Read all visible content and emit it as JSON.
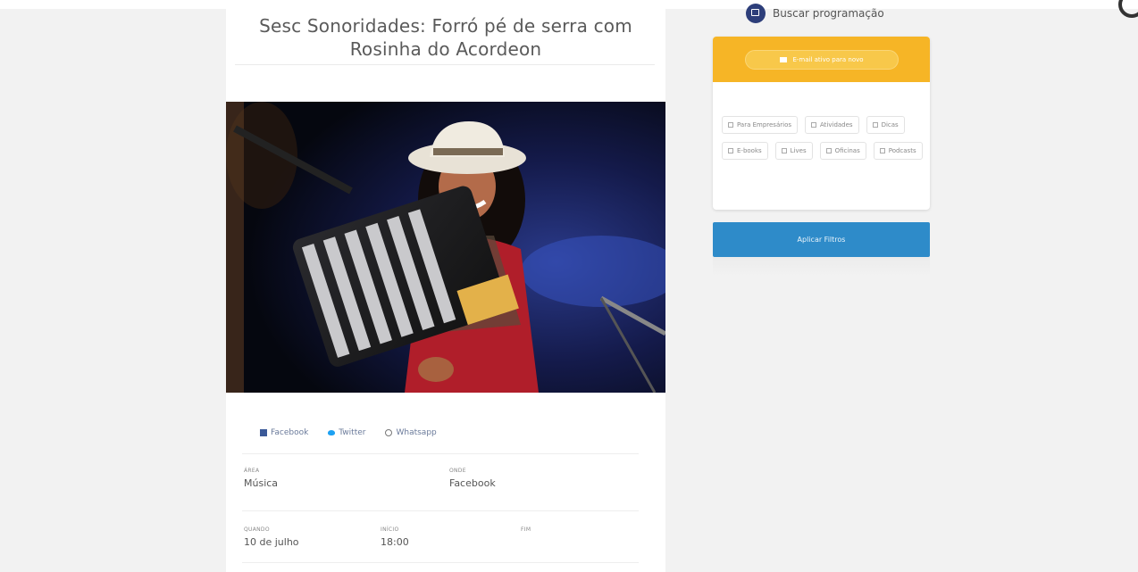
{
  "article": {
    "title": "Sesc Sonoridades: Forró pé de serra com Rosinha do Acordeon",
    "share": {
      "facebook": "Facebook",
      "twitter": "Twitter",
      "whatsapp": "Whatsapp"
    },
    "meta": {
      "area_label": "ÁREA",
      "area_value": "Música",
      "onde_label": "ONDE",
      "onde_value": "Facebook",
      "quando_label": "QUANDO",
      "quando_value": "10 de julho",
      "inicio_label": "INÍCIO",
      "inicio_value": "18:00",
      "fim_label": "FIM"
    }
  },
  "sidebar": {
    "search_label": "Buscar programação",
    "email_pill": "E-mail ativo para novo",
    "filters": [
      "Para Empresários",
      "Atividades",
      "Dicas",
      "E-books",
      "Lives",
      "Oficinas",
      "Podcasts"
    ],
    "apply_label": "Aplicar Filtros"
  },
  "colors": {
    "accent_yellow": "#f6b526",
    "accent_blue": "#2e8bc9",
    "navy": "#2d3e7a"
  }
}
